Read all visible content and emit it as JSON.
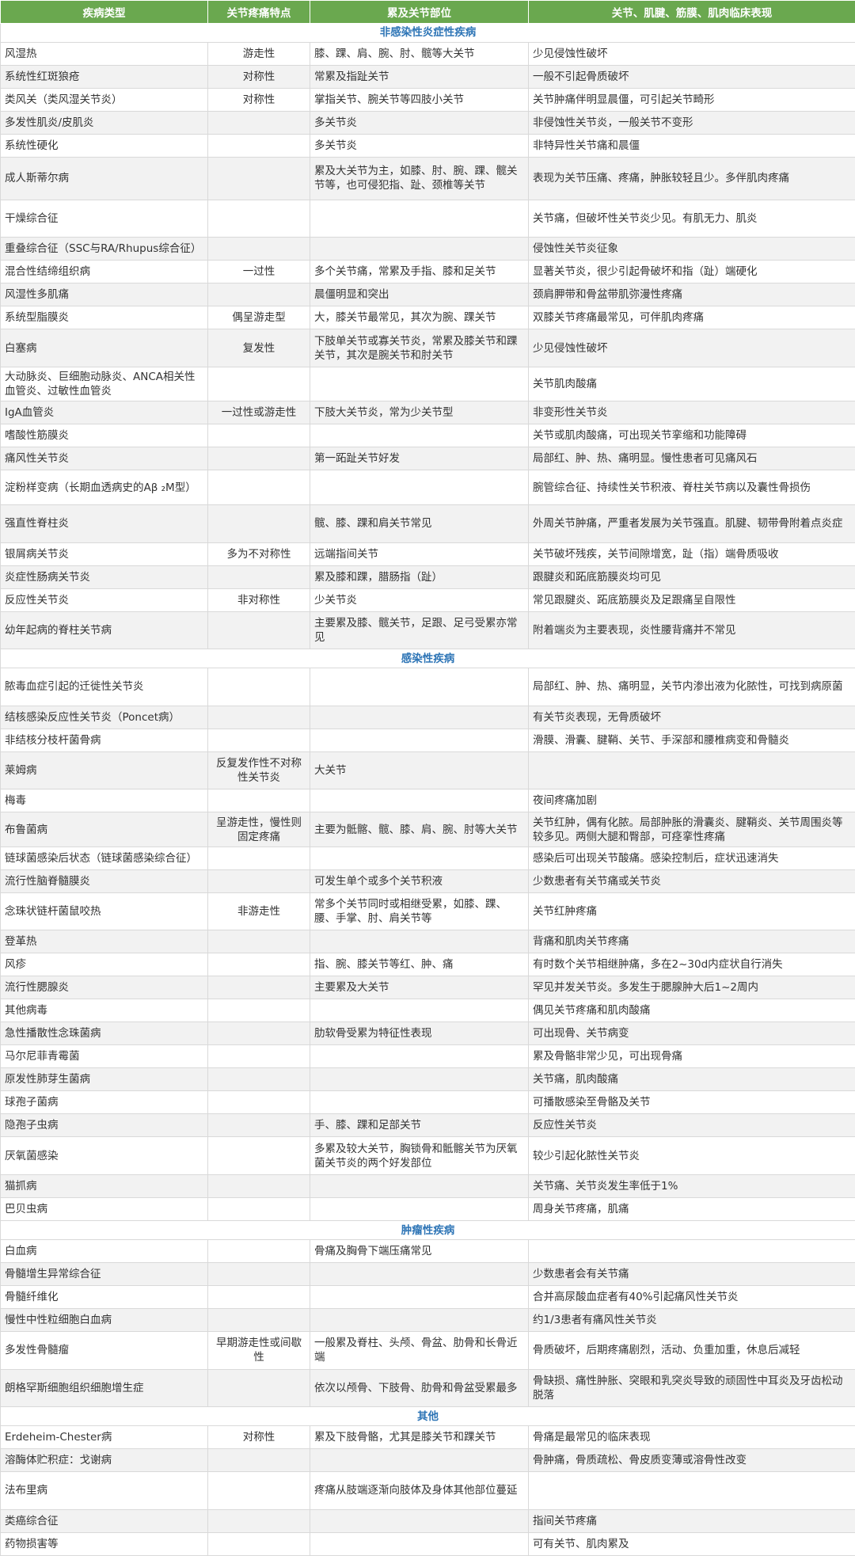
{
  "headers": [
    "疾病类型",
    "关节疼痛特点",
    "累及关节部位",
    "关节、肌腱、筋膜、肌肉临床表现"
  ],
  "sections": [
    {
      "title": "非感染性炎症性疾病",
      "rows": [
        {
          "h": 28,
          "cells": [
            "风湿热",
            "游走性",
            "膝、踝、肩、腕、肘、髋等大关节",
            "少见侵蚀性破坏"
          ]
        },
        {
          "h": 28,
          "cells": [
            "系统性红斑狼疮",
            "对称性",
            "常累及指趾关节",
            "一般不引起骨质破坏"
          ]
        },
        {
          "h": 28,
          "cells": [
            "类风关（类风湿关节炎）",
            "对称性",
            "掌指关节、腕关节等四肢小关节",
            "关节肿痛伴明显晨僵，可引起关节畸形"
          ]
        },
        {
          "h": 28,
          "cells": [
            "多发性肌炎/皮肌炎",
            "",
            "多关节炎",
            "非侵蚀性关节炎，一般关节不变形"
          ]
        },
        {
          "h": 28,
          "cells": [
            "系统性硬化",
            "",
            "多关节炎",
            "非特异性关节痛和晨僵"
          ]
        },
        {
          "h": 52,
          "cells": [
            "成人斯蒂尔病",
            "",
            "累及大关节为主，如膝、肘、腕、踝、髋关节等，也可侵犯指、趾、颈椎等关节",
            "表现为关节压痛、疼痛，肿胀较轻且少。多伴肌肉疼痛"
          ]
        },
        {
          "h": 46,
          "cells": [
            "干燥综合征",
            "",
            "",
            "关节痛，但破坏性关节炎少见。有肌无力、肌炎"
          ]
        },
        {
          "h": 28,
          "cells": [
            "重叠综合征（SSC与RA/Rhupus综合征）",
            "",
            "",
            "侵蚀性关节炎征象"
          ]
        },
        {
          "h": 28,
          "cells": [
            "混合性结缔组织病",
            "一过性",
            "多个关节痛，常累及手指、膝和足关节",
            "显著关节炎，很少引起骨破坏和指（趾）端硬化"
          ]
        },
        {
          "h": 28,
          "cells": [
            "风湿性多肌痛",
            "",
            "晨僵明显和突出",
            "颈肩胛带和骨盆带肌弥漫性疼痛"
          ]
        },
        {
          "h": 28,
          "cells": [
            "系统型脂膜炎",
            "偶呈游走型",
            "大，膝关节最常见，其次为腕、踝关节",
            "双膝关节疼痛最常见，可伴肌肉疼痛"
          ]
        },
        {
          "h": 46,
          "cells": [
            "白塞病",
            "复发性",
            "下肢单关节或寡关节炎，常累及膝关节和踝关节，其次是腕关节和肘关节",
            "少见侵蚀性破坏"
          ]
        },
        {
          "h": 42,
          "cells": [
            "大动脉炎、巨细胞动脉炎、ANCA相关性血管炎、过敏性血管炎",
            "",
            "",
            "关节肌肉酸痛"
          ]
        },
        {
          "h": 28,
          "cells": [
            "IgA血管炎",
            "一过性或游走性",
            "下肢大关节炎，常为少关节型",
            "非变形性关节炎"
          ]
        },
        {
          "h": 28,
          "cells": [
            "嗜酸性筋膜炎",
            "",
            "",
            "关节或肌肉酸痛，可出现关节挛缩和功能障碍"
          ]
        },
        {
          "h": 28,
          "cells": [
            "痛风性关节炎",
            "",
            "第一跖趾关节好发",
            "局部红、肿、热、痛明显。慢性患者可见痛风石"
          ]
        },
        {
          "h": 42,
          "cells": [
            "淀粉样变病（长期血透病史的Aβ ₂M型）",
            "",
            "",
            "腕管综合征、持续性关节积液、脊柱关节病以及囊性骨损伤"
          ]
        },
        {
          "h": 46,
          "cells": [
            "强直性脊柱炎",
            "",
            "髋、膝、踝和肩关节常见",
            "外周关节肿痛，严重者发展为关节强直。肌腱、韧带骨附着点炎症"
          ]
        },
        {
          "h": 28,
          "cells": [
            "银屑病关节炎",
            "多为不对称性",
            "远端指间关节",
            "关节破坏残疾，关节间隙增宽，趾（指）端骨质吸收"
          ]
        },
        {
          "h": 28,
          "cells": [
            "炎症性肠病关节炎",
            "",
            "累及膝和踝，腊肠指（趾）",
            "跟腱炎和跖底筋膜炎均可见"
          ]
        },
        {
          "h": 28,
          "cells": [
            "反应性关节炎",
            "非对称性",
            "少关节炎",
            "常见跟腱炎、跖底筋膜炎及足跟痛呈自限性"
          ]
        },
        {
          "h": 46,
          "cells": [
            "幼年起病的脊柱关节病",
            "",
            "主要累及膝、髋关节，足跟、足弓受累亦常见",
            "附着端炎为主要表现，炎性腰背痛并不常见"
          ]
        }
      ]
    },
    {
      "title": "感染性疾病",
      "rows": [
        {
          "h": 46,
          "cells": [
            "脓毒血症引起的迁徙性关节炎",
            "",
            "",
            "局部红、肿、热、痛明显，关节内渗出液为化脓性，可找到病原菌"
          ]
        },
        {
          "h": 28,
          "cells": [
            "结核感染反应性关节炎（Poncet病）",
            "",
            "",
            "有关节炎表现，无骨质破坏"
          ]
        },
        {
          "h": 28,
          "cells": [
            "非结核分枝杆菌骨病",
            "",
            "",
            "滑膜、滑囊、腱鞘、关节、手深部和腰椎病变和骨髓炎"
          ]
        },
        {
          "h": 46,
          "cells": [
            "莱姆病",
            "反复发作性不对称性关节炎",
            "大关节",
            ""
          ]
        },
        {
          "h": 28,
          "cells": [
            "梅毒",
            "",
            "",
            "夜间疼痛加剧"
          ]
        },
        {
          "h": 42,
          "cells": [
            "布鲁菌病",
            "呈游走性，慢性则固定疼痛",
            "主要为骶髂、髋、膝、肩、腕、肘等大关节",
            "关节红肿，偶有化脓。局部肿胀的滑囊炎、腱鞘炎、关节周围炎等较多见。两侧大腿和臀部，可痉挛性疼痛"
          ]
        },
        {
          "h": 28,
          "cells": [
            "链球菌感染后状态（链球菌感染综合征）",
            "",
            "",
            "感染后可出现关节酸痛。感染控制后，症状迅速消失"
          ]
        },
        {
          "h": 28,
          "cells": [
            "流行性脑脊髓膜炎",
            "",
            "可发生单个或多个关节积液",
            "少数患者有关节痛或关节炎"
          ]
        },
        {
          "h": 46,
          "cells": [
            "念珠状链杆菌鼠咬热",
            "非游走性",
            "常多个关节同时或相继受累，如膝、踝、腰、手掌、肘、肩关节等",
            "关节红肿疼痛"
          ]
        },
        {
          "h": 28,
          "cells": [
            "登革热",
            "",
            "",
            "背痛和肌肉关节疼痛"
          ]
        },
        {
          "h": 28,
          "cells": [
            "风疹",
            "",
            "指、腕、膝关节等红、肿、痛",
            "有时数个关节相继肿痛，多在2~30d内症状自行消失"
          ]
        },
        {
          "h": 28,
          "cells": [
            "流行性腮腺炎",
            "",
            "主要累及大关节",
            "罕见并发关节炎。多发生于腮腺肿大后1~2周内"
          ]
        },
        {
          "h": 28,
          "cells": [
            "其他病毒",
            "",
            "",
            "偶见关节疼痛和肌肉酸痛"
          ]
        },
        {
          "h": 28,
          "cells": [
            "急性播散性念珠菌病",
            "",
            "肋软骨受累为特征性表现",
            "可出现骨、关节病变"
          ]
        },
        {
          "h": 28,
          "cells": [
            "马尔尼菲青霉菌",
            "",
            "",
            "累及骨骼非常少见，可出现骨痛"
          ]
        },
        {
          "h": 28,
          "cells": [
            "原发性肺芽生菌病",
            "",
            "",
            "关节痛，肌肉酸痛"
          ]
        },
        {
          "h": 28,
          "cells": [
            "球孢子菌病",
            "",
            "",
            "可播散感染至骨骼及关节"
          ]
        },
        {
          "h": 28,
          "cells": [
            "隐孢子虫病",
            "",
            "手、膝、踝和足部关节",
            "反应性关节炎"
          ]
        },
        {
          "h": 46,
          "cells": [
            "厌氧菌感染",
            "",
            "多累及较大关节，胸锁骨和骶髂关节为厌氧菌关节炎的两个好发部位",
            "较少引起化脓性关节炎"
          ]
        },
        {
          "h": 28,
          "cells": [
            "猫抓病",
            "",
            "",
            "关节痛、关节炎发生率低于1%"
          ]
        },
        {
          "h": 28,
          "cells": [
            "巴贝虫病",
            "",
            "",
            "周身关节疼痛，肌痛"
          ]
        }
      ]
    },
    {
      "title": "肿瘤性疾病",
      "rows": [
        {
          "h": 28,
          "cells": [
            "白血病",
            "",
            "骨痛及胸骨下端压痛常见",
            ""
          ]
        },
        {
          "h": 28,
          "cells": [
            "骨髓增生异常综合征",
            "",
            "",
            "少数患者会有关节痛"
          ]
        },
        {
          "h": 28,
          "cells": [
            "骨髓纤维化",
            "",
            "",
            "合并高尿酸血症者有40%引起痛风性关节炎"
          ]
        },
        {
          "h": 28,
          "cells": [
            "慢性中性粒细胞白血病",
            "",
            "",
            "约1/3患者有痛风性关节炎"
          ]
        },
        {
          "h": 46,
          "cells": [
            "多发性骨髓瘤",
            "早期游走性或间歇性",
            "一般累及脊柱、头颅、骨盆、肋骨和长骨近端",
            "骨质破坏，后期疼痛剧烈，活动、负重加重，休息后减轻"
          ]
        },
        {
          "h": 46,
          "cells": [
            "朗格罕斯细胞组织细胞增生症",
            "",
            "依次以颅骨、下肢骨、肋骨和骨盆受累最多",
            "骨缺损、痛性肿胀、突眼和乳突炎导致的顽固性中耳炎及牙齿松动脱落"
          ]
        }
      ]
    },
    {
      "title": "其他",
      "rows": [
        {
          "h": 28,
          "cells": [
            "Erdeheim-Chester病",
            "对称性",
            "累及下肢骨骼，尤其是膝关节和踝关节",
            "骨痛是最常见的临床表现"
          ]
        },
        {
          "h": 28,
          "cells": [
            "溶酶体贮积症：戈谢病",
            "",
            "",
            "骨肿痛，骨质疏松、骨皮质变薄或溶骨性改变"
          ]
        },
        {
          "h": 46,
          "cells": [
            "法布里病",
            "",
            "疼痛从肢端逐渐向肢体及身体其他部位蔓延",
            ""
          ]
        },
        {
          "h": 28,
          "cells": [
            "类癌综合征",
            "",
            "",
            "指间关节疼痛"
          ]
        },
        {
          "h": 28,
          "cells": [
            "药物损害等",
            "",
            "",
            "可有关节、肌肉累及"
          ]
        }
      ]
    }
  ]
}
